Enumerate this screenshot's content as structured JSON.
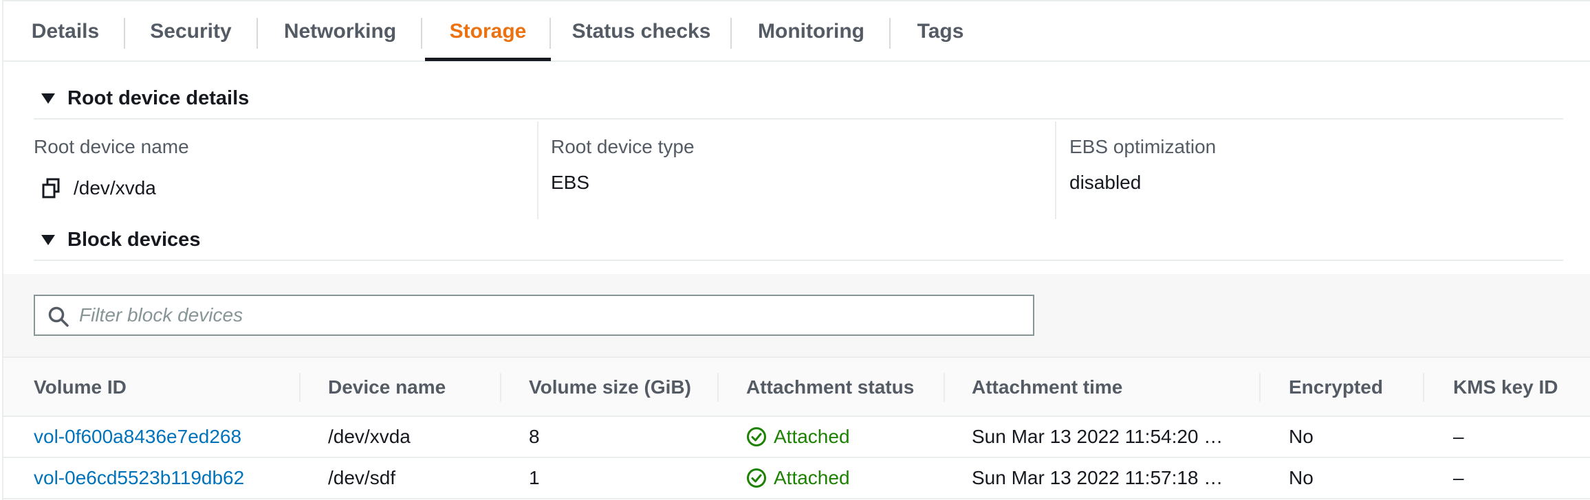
{
  "tabs": [
    {
      "label": "Details"
    },
    {
      "label": "Security"
    },
    {
      "label": "Networking"
    },
    {
      "label": "Storage",
      "active": true
    },
    {
      "label": "Status checks"
    },
    {
      "label": "Monitoring"
    },
    {
      "label": "Tags"
    }
  ],
  "root_device": {
    "section_title": "Root device details",
    "name_label": "Root device name",
    "name_value": "/dev/xvda",
    "type_label": "Root device type",
    "type_value": "EBS",
    "ebs_label": "EBS optimization",
    "ebs_value": "disabled"
  },
  "block_devices": {
    "section_title": "Block devices",
    "filter_placeholder": "Filter block devices",
    "columns": [
      "Volume ID",
      "Device name",
      "Volume size (GiB)",
      "Attachment status",
      "Attachment time",
      "Encrypted",
      "KMS key ID"
    ],
    "rows": [
      {
        "volume_id": "vol-0f600a8436e7ed268",
        "device": "/dev/xvda",
        "size": "8",
        "status": "Attached",
        "time": "Sun Mar 13 2022 11:54:20 …",
        "encrypted": "No",
        "kms": "–"
      },
      {
        "volume_id": "vol-0e6cd5523b119db62",
        "device": "/dev/sdf",
        "size": "1",
        "status": "Attached",
        "time": "Sun Mar 13 2022 11:57:18 …",
        "encrypted": "No",
        "kms": "–"
      }
    ]
  },
  "colors": {
    "accent": "#ec7211",
    "link": "#0073bb",
    "success": "#1d8102"
  },
  "icons": [
    "copy-icon",
    "search-icon",
    "check-circle-icon",
    "caret-down-icon"
  ]
}
